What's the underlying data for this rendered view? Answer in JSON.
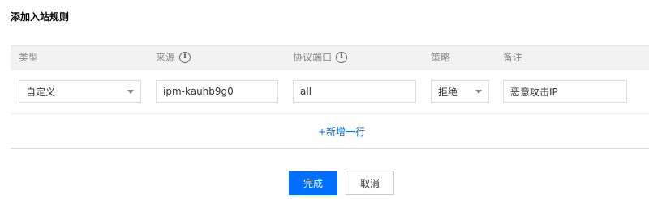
{
  "dialog": {
    "title": "添加入站规则"
  },
  "columns": [
    {
      "label": "类型",
      "info": false
    },
    {
      "label": "来源",
      "info": true
    },
    {
      "label": "协议端口",
      "info": true
    },
    {
      "label": "策略",
      "info": false
    },
    {
      "label": "备注",
      "info": false
    }
  ],
  "row": {
    "type": "自定义",
    "source": "ipm-kauhb9g0",
    "port": "all",
    "policy": "拒绝",
    "remark": "恶意攻击IP"
  },
  "actions": {
    "add_row": "+新增一行",
    "confirm": "完成",
    "cancel": "取消"
  },
  "colors": {
    "primary": "#006eff",
    "header_bg": "#f2f2f2"
  },
  "icons": {
    "info": "info-circle-icon",
    "dropdown": "chevron-down-icon"
  }
}
